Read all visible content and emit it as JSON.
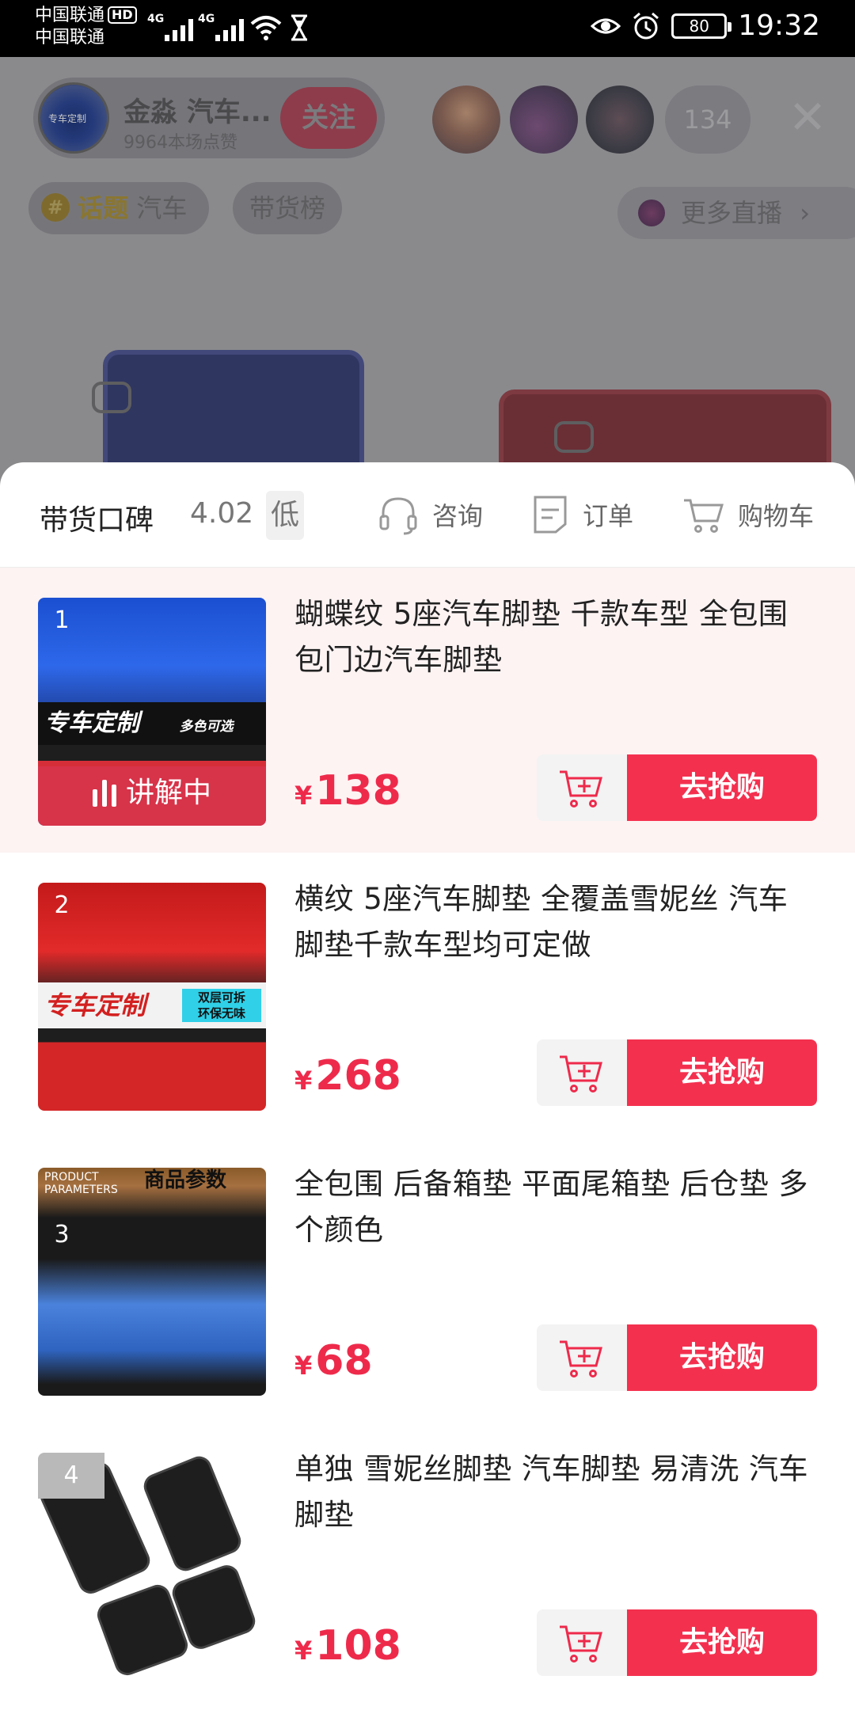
{
  "status_bar": {
    "carrier_1": "中国联通",
    "hd_badge": "HD",
    "carrier_2": "中国联通",
    "net_1": "4G",
    "net_2": "4G",
    "battery": "80",
    "time": "19:32"
  },
  "live": {
    "host_avatar_text": "专车定制",
    "host_name": "金淼 汽车...",
    "host_likes": "9964本场点赞",
    "follow_label": "关注",
    "viewer_count": "134",
    "close_glyph": "✕",
    "topic_icon": "#",
    "topic_word": "话题",
    "topic_name": "汽车",
    "rank_tag": "带货榜",
    "more_live": "更多直播"
  },
  "sheet": {
    "rating_label": "带货口碑",
    "rating_score": "4.02",
    "rating_level": "低",
    "actions": [
      {
        "label": "咨询",
        "icon": "headset-icon"
      },
      {
        "label": "订单",
        "icon": "order-icon"
      },
      {
        "label": "购物车",
        "icon": "cart-icon"
      }
    ],
    "currency": "¥",
    "buy_label": "去抢购",
    "live_badge": "讲解中",
    "items": [
      {
        "rank": "1",
        "title": "蝴蝶纹  5座汽车脚垫 千款车型 全包围包门边汽车脚垫",
        "price": "138",
        "banner": "专车定制",
        "banner_sub": "多色可选",
        "is_explaining": true
      },
      {
        "rank": "2",
        "title": "横纹 5座汽车脚垫 全覆盖雪妮丝 汽车脚垫千款车型均可定做",
        "price": "268",
        "banner": "专车定制",
        "banner_sub_1": "双层可拆",
        "banner_sub_2": "环保无味"
      },
      {
        "rank": "3",
        "title": "全包围 后备箱垫 平面尾箱垫 后仓垫 多个颜色",
        "price": "68",
        "banner_line1": "PRODUCT",
        "banner_line2": "PARAMETERS",
        "banner": "商品参数"
      },
      {
        "rank": "4",
        "title": "单独 雪妮丝脚垫  汽车脚垫  易清洗 汽车脚垫",
        "price": "108"
      }
    ]
  },
  "colors": {
    "accent": "#f4304f",
    "price": "#ee2a4b",
    "active_row_bg": "#fdf3f3"
  }
}
